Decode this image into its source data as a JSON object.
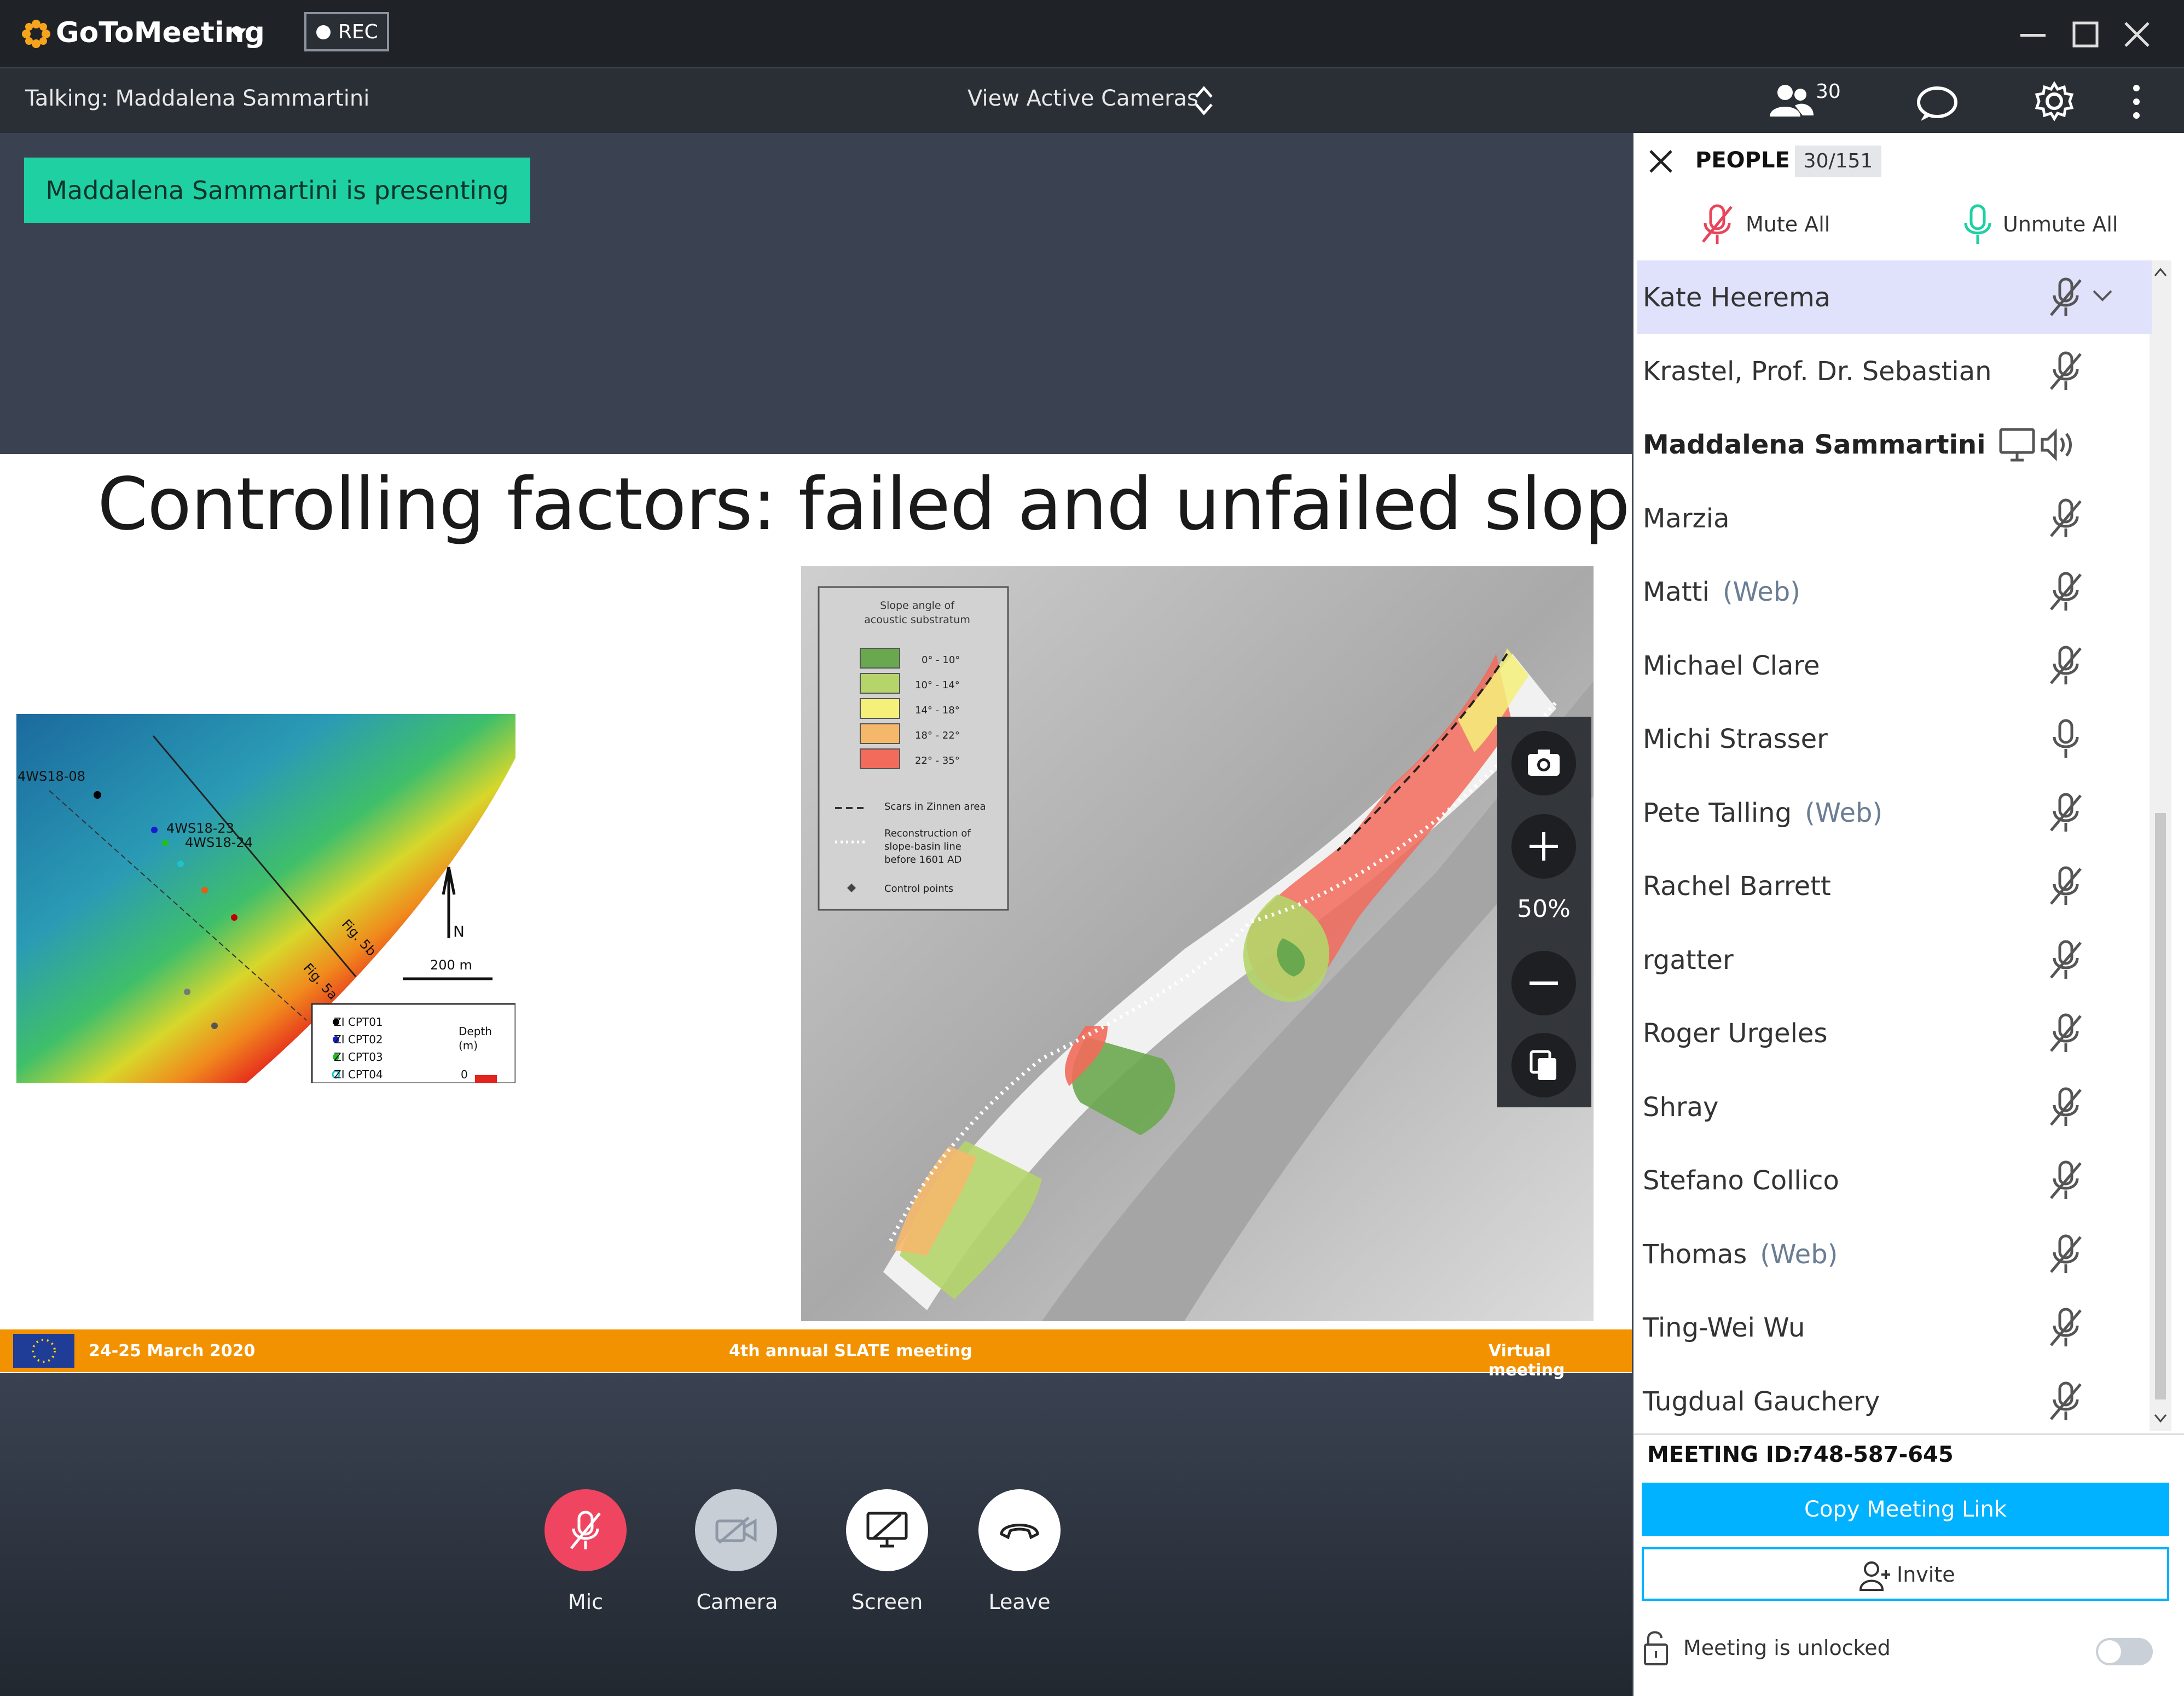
{
  "app": {
    "name": "GoToMeeting",
    "rec_label": "REC",
    "window_controls": [
      "minimize-icon",
      "maximize-icon",
      "close-icon"
    ]
  },
  "topbar": {
    "talking": "Talking: Maddalena Sammartini",
    "view_cameras": "View Active Cameras",
    "people_count": "30"
  },
  "stage": {
    "presenting_banner": "Maddalena Sammartini is presenting",
    "zoom_level": "50%"
  },
  "slide": {
    "title": "Controlling factors: failed and unfailed slope",
    "left_map": {
      "labels": [
        "4WS18-08",
        "4WS18-23",
        "4WS18-24",
        "Fig. 5b",
        "Fig. 5a",
        "N",
        "200 m"
      ],
      "legend_title": "Depth (m)",
      "legend_items": [
        "ZI CPT01",
        "ZI CPT02",
        "ZI CPT03",
        "ZI CPT04"
      ],
      "legend_value": "0"
    },
    "right_map": {
      "legend_title": "Slope angle of acoustic substratum",
      "legend_items": [
        {
          "label": "0° - 10°",
          "color": "#6aa84f"
        },
        {
          "label": "10° - 14°",
          "color": "#b5d56a"
        },
        {
          "label": "14° - 18°",
          "color": "#f4f07a"
        },
        {
          "label": "18° - 22°",
          "color": "#f5b86b"
        },
        {
          "label": "22° - 35°",
          "color": "#f26b5b"
        }
      ],
      "line_items": [
        "Scars in Zinnen area",
        "Reconstruction of slope-basin line before 1601 AD",
        "Control points"
      ]
    },
    "footer": {
      "left": "24-25 March 2020",
      "center": "4th annual SLATE meeting",
      "right": "Virtual meeting"
    }
  },
  "controls": [
    {
      "label": "Mic"
    },
    {
      "label": "Camera"
    },
    {
      "label": "Screen"
    },
    {
      "label": "Leave"
    }
  ],
  "people_panel": {
    "title": "PEOPLE",
    "count": "30/151",
    "mute_all": "Mute All",
    "unmute_all": "Unmute All",
    "participants": [
      {
        "name": "Kate Heerema",
        "web": "",
        "status": "muted"
      },
      {
        "name": "Krastel, Prof. Dr. Sebastian",
        "web": "",
        "status": "muted"
      },
      {
        "name": "Maddalena Sammartini",
        "web": "",
        "status": "presenting"
      },
      {
        "name": "Marzia",
        "web": "",
        "status": "muted"
      },
      {
        "name": "Matti",
        "web": "(Web)",
        "status": "muted"
      },
      {
        "name": "Michael Clare",
        "web": "",
        "status": "muted"
      },
      {
        "name": "Michi Strasser",
        "web": "",
        "status": "unmuted"
      },
      {
        "name": "Pete Talling",
        "web": "(Web)",
        "status": "muted"
      },
      {
        "name": "Rachel Barrett",
        "web": "",
        "status": "muted"
      },
      {
        "name": "rgatter",
        "web": "",
        "status": "muted"
      },
      {
        "name": "Roger Urgeles",
        "web": "",
        "status": "muted"
      },
      {
        "name": "Shray",
        "web": "",
        "status": "muted"
      },
      {
        "name": "Stefano Collico",
        "web": "",
        "status": "muted"
      },
      {
        "name": "Thomas",
        "web": "(Web)",
        "status": "muted"
      },
      {
        "name": "Ting-Wei Wu",
        "web": "",
        "status": "muted"
      },
      {
        "name": "Tugdual Gauchery",
        "web": "",
        "status": "muted"
      }
    ],
    "meeting_id_label": "MEETING ID:",
    "meeting_id": "748-587-645",
    "copy_link": "Copy Meeting Link",
    "invite": "Invite",
    "lock_status": "Meeting is unlocked"
  },
  "colors": {
    "accent_teal": "#1ed0a2",
    "copy_link_blue": "#00b2ff",
    "footer_orange": "#f39200",
    "mute_red": "#e8445a",
    "unmute_green": "#1ed0a2"
  }
}
